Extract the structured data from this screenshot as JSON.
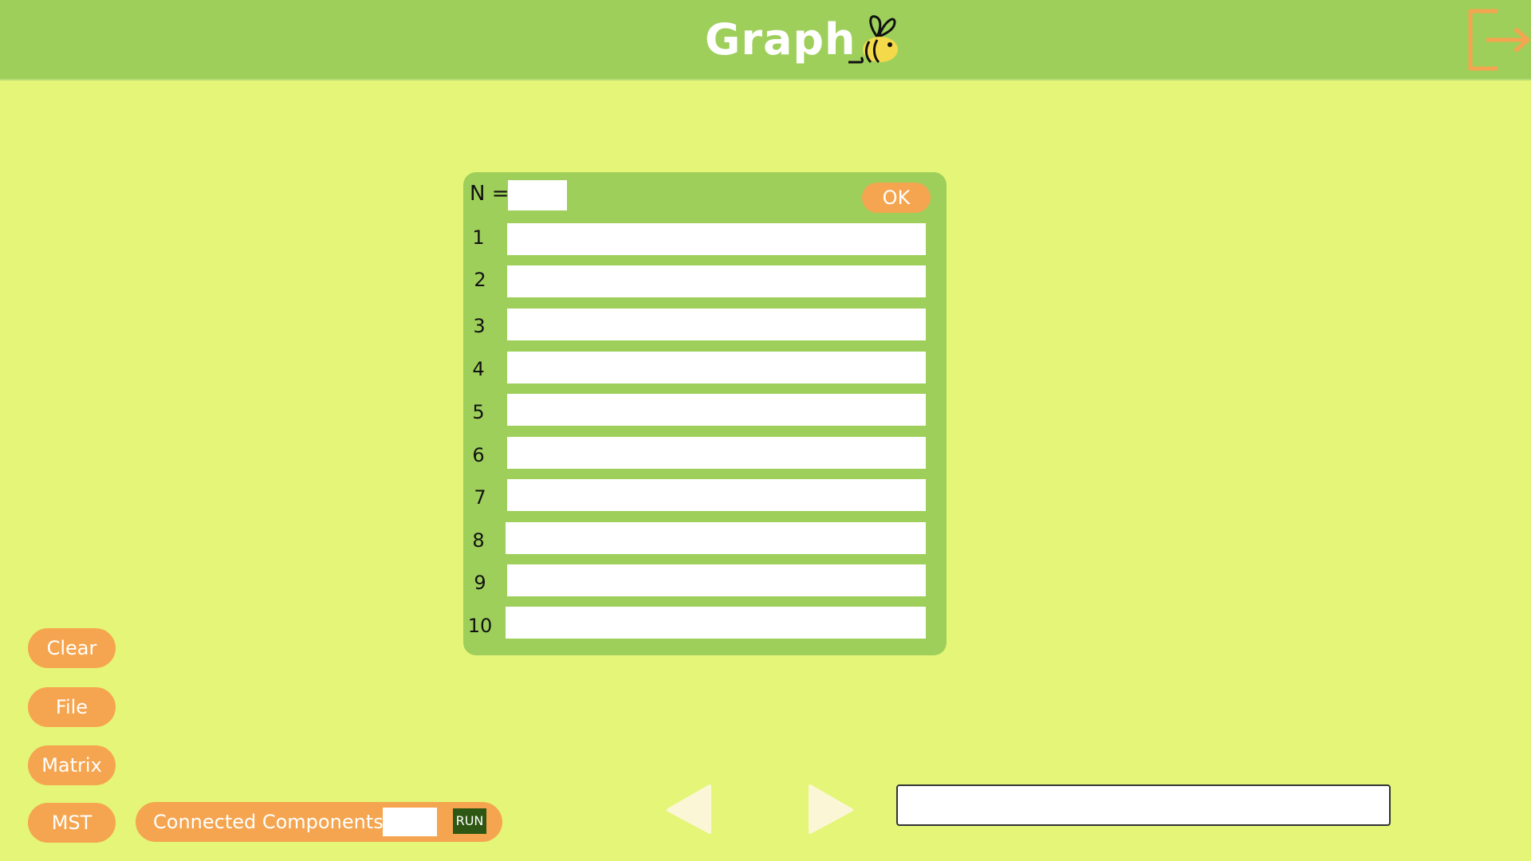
{
  "header": {
    "title": "Graph",
    "logo_icon": "bee-icon",
    "logout_icon": "logout-icon",
    "background": "#9ecf5b"
  },
  "colors": {
    "page_background": "#e5f578",
    "panel_background": "#9ecf5b",
    "accent": "#f5a54f",
    "run_button": "#2e5713"
  },
  "adjacency_panel": {
    "n_label": "N =",
    "n_value": "",
    "ok_label": "OK",
    "rows": [
      {
        "label": "1",
        "value": ""
      },
      {
        "label": "2",
        "value": ""
      },
      {
        "label": "3",
        "value": ""
      },
      {
        "label": "4",
        "value": ""
      },
      {
        "label": "5",
        "value": ""
      },
      {
        "label": "6",
        "value": ""
      },
      {
        "label": "7",
        "value": ""
      },
      {
        "label": "8",
        "value": ""
      },
      {
        "label": "9",
        "value": ""
      },
      {
        "label": "10",
        "value": ""
      }
    ]
  },
  "sidebar": {
    "buttons": [
      {
        "label": "Clear"
      },
      {
        "label": "File"
      },
      {
        "label": "Matrix"
      },
      {
        "label": "MST"
      }
    ]
  },
  "connected_components": {
    "label": "Connected Components:",
    "value": "",
    "run_label": "RUN"
  },
  "navigation": {
    "prev_icon": "triangle-left-icon",
    "next_icon": "triangle-right-icon"
  },
  "status_field": {
    "value": ""
  }
}
